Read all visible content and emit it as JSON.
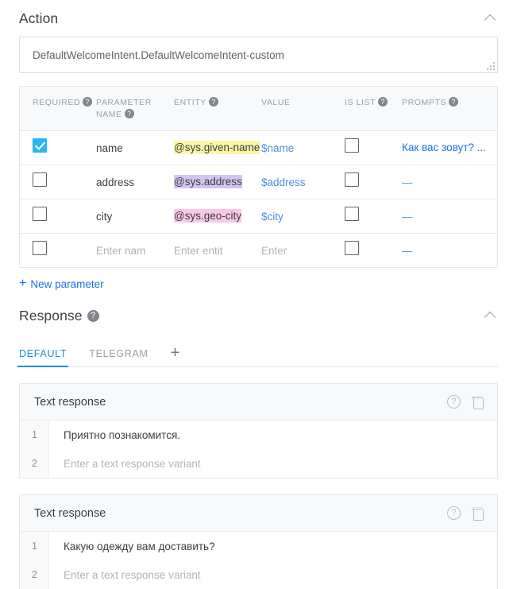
{
  "action": {
    "title": "Action",
    "collapse_icon": "chevron-up-icon",
    "value": "DefaultWelcomeIntent.DefaultWelcomeIntent-custom",
    "resize_handle": "resize-grip-icon"
  },
  "params_table": {
    "columns": [
      {
        "label": "REQUIRED",
        "help": true
      },
      {
        "label": "PARAMETER NAME",
        "help": true
      },
      {
        "label": "ENTITY",
        "help": true
      },
      {
        "label": "VALUE",
        "help": false
      },
      {
        "label": "IS LIST",
        "help": true
      },
      {
        "label": "PROMPTS",
        "help": true
      }
    ],
    "help_glyph": "?",
    "rows": [
      {
        "required": true,
        "name": "name",
        "entity": "@sys.given-name",
        "entity_color": "#fdf5a6",
        "value": "$name",
        "is_list": false,
        "prompts": "Как вас зовут? ...",
        "prompts_is_link": true
      },
      {
        "required": false,
        "name": "address",
        "entity": "@sys.address",
        "entity_color": "#d3c5ef",
        "value": "$address",
        "is_list": false,
        "prompts": "—",
        "prompts_is_link": false
      },
      {
        "required": false,
        "name": "city",
        "entity": "@sys.geo-city",
        "entity_color": "#fbc7e8",
        "value": "$city",
        "is_list": false,
        "prompts": "—",
        "prompts_is_link": false
      },
      {
        "required": false,
        "name": "Enter nam",
        "name_is_placeholder": true,
        "entity": "Enter entit",
        "entity_is_placeholder": true,
        "value": "Enter",
        "value_is_placeholder": true,
        "is_list": false,
        "prompts": "—",
        "prompts_is_link": false
      }
    ]
  },
  "new_parameter": {
    "plus": "+",
    "label": "New parameter"
  },
  "response": {
    "title": "Response",
    "help_glyph": "?",
    "collapse_icon": "chevron-up-icon",
    "tabs": [
      {
        "label": "DEFAULT",
        "active": true
      },
      {
        "label": "TELEGRAM",
        "active": false
      }
    ],
    "add_tab": "+",
    "cards": [
      {
        "title": "Text response",
        "help_glyph": "?",
        "delete_icon": "trash-icon",
        "variants": [
          {
            "num": "1",
            "text": "Приятно познакомится.",
            "placeholder": false
          },
          {
            "num": "2",
            "text": "Enter a text response variant",
            "placeholder": true
          }
        ]
      },
      {
        "title": "Text response",
        "help_glyph": "?",
        "delete_icon": "trash-icon",
        "variants": [
          {
            "num": "1",
            "text": "Какую одежду вам доставить?",
            "placeholder": false
          },
          {
            "num": "2",
            "text": "Enter a text response variant",
            "placeholder": true
          }
        ]
      }
    ]
  },
  "colors": {
    "accent_blue": "#1a73e8",
    "checkbox_blue": "#29b6f6",
    "tab_blue": "#1a8fd1",
    "entity_yellow": "#fdf5a6",
    "entity_purple": "#d3c5ef",
    "entity_pink": "#fbc7e8"
  }
}
